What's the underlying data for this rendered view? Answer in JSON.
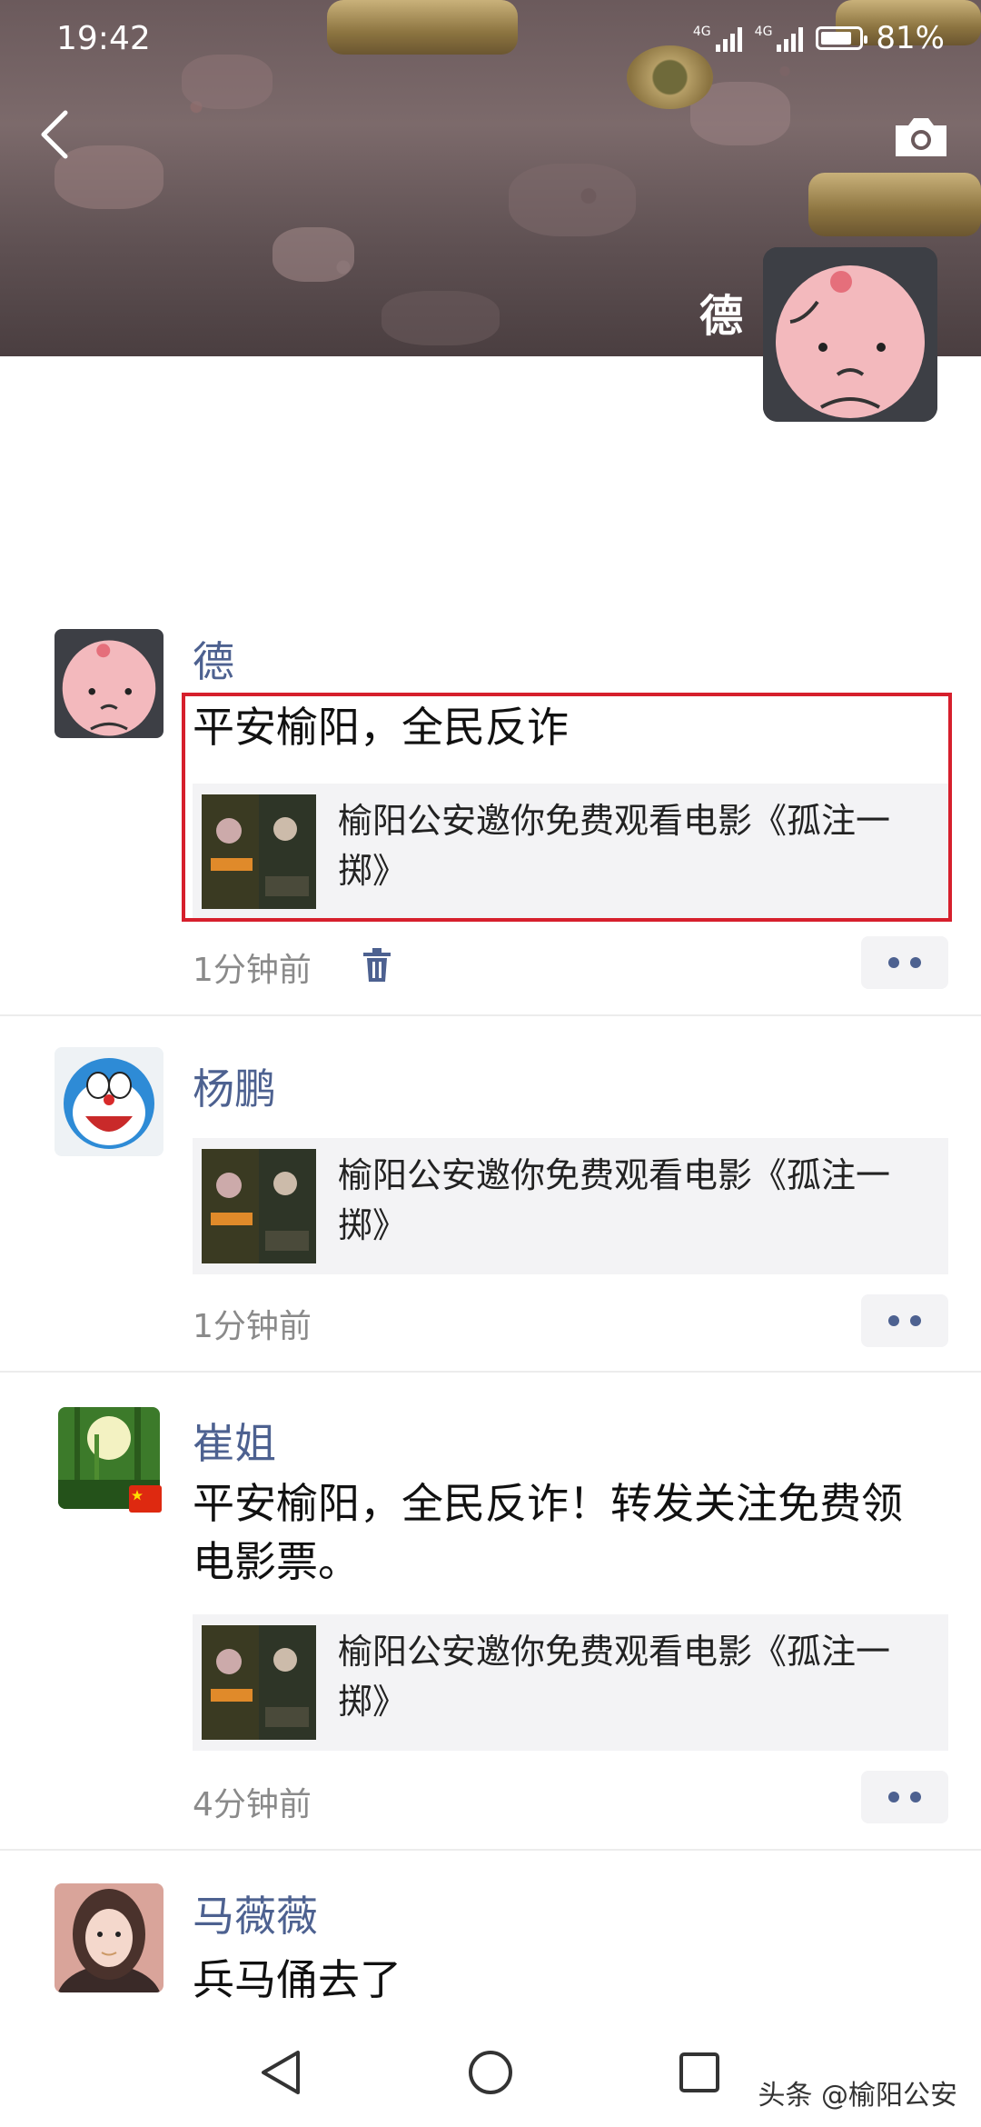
{
  "status_bar": {
    "time": "19:42",
    "network_1": "4G",
    "network_2": "4G",
    "battery_percent": "81%",
    "battery_level": 0.81
  },
  "cover": {
    "user_name": "德"
  },
  "posts": [
    {
      "author": "德",
      "text": "平安榆阳，全民反诈",
      "share_title": "榆阳公安邀你免费观看电影《孤注一掷》",
      "time": "1分钟前",
      "highlighted": true
    },
    {
      "author": "杨鹏",
      "text": "",
      "share_title": "榆阳公安邀你免费观看电影《孤注一掷》",
      "time": "1分钟前"
    },
    {
      "author": "崔姐",
      "text": "平安榆阳，全民反诈！转发关注免费领电影票。",
      "share_title": "榆阳公安邀你免费观看电影《孤注一掷》",
      "time": "4分钟前"
    },
    {
      "author": "马薇薇",
      "text": "兵马俑去了"
    }
  ],
  "watermark": "头条 @榆阳公安",
  "colors": {
    "author": "#4d6190",
    "highlight": "#d61f2c"
  }
}
